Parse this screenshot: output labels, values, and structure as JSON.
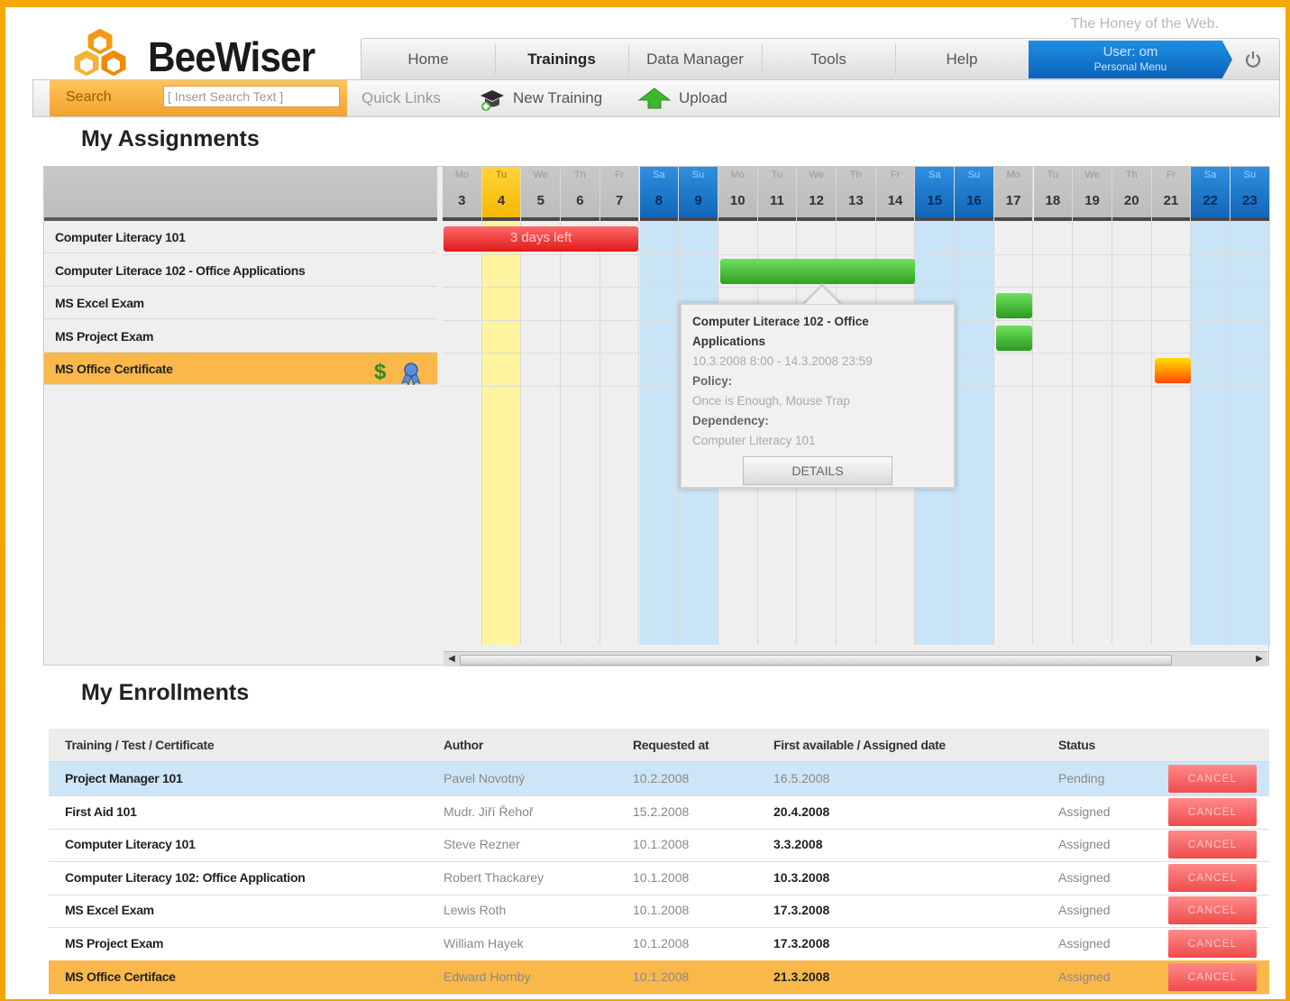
{
  "brand": {
    "logo_text": "BeeWiser",
    "tagline": "The Honey of the Web."
  },
  "nav": {
    "items": [
      "Home",
      "Trainings",
      "Data Manager",
      "Tools",
      "Help"
    ],
    "user_line1": "User: om",
    "user_line2": "Personal Menu"
  },
  "toolbar": {
    "search_label": "Search",
    "search_value": "[ Insert Search Text ]",
    "quick_links": "Quick Links",
    "new_training": "New Training",
    "upload": "Upload"
  },
  "assignments": {
    "title": "My Assignments",
    "days": [
      {
        "name": "Mo",
        "num": "3",
        "kind": "weekday"
      },
      {
        "name": "Tu",
        "num": "4",
        "kind": "today"
      },
      {
        "name": "We",
        "num": "5",
        "kind": "weekday"
      },
      {
        "name": "Th",
        "num": "6",
        "kind": "weekday"
      },
      {
        "name": "Fr",
        "num": "7",
        "kind": "weekday"
      },
      {
        "name": "Sa",
        "num": "8",
        "kind": "weekend"
      },
      {
        "name": "Su",
        "num": "9",
        "kind": "weekend"
      },
      {
        "name": "Mo",
        "num": "10",
        "kind": "weekday"
      },
      {
        "name": "Tu",
        "num": "11",
        "kind": "weekday"
      },
      {
        "name": "We",
        "num": "12",
        "kind": "weekday"
      },
      {
        "name": "Th",
        "num": "13",
        "kind": "weekday"
      },
      {
        "name": "Fr",
        "num": "14",
        "kind": "weekday"
      },
      {
        "name": "Sa",
        "num": "15",
        "kind": "weekend"
      },
      {
        "name": "Su",
        "num": "16",
        "kind": "weekend"
      },
      {
        "name": "Mo",
        "num": "17",
        "kind": "weekday"
      },
      {
        "name": "Tu",
        "num": "18",
        "kind": "weekday"
      },
      {
        "name": "We",
        "num": "19",
        "kind": "weekday"
      },
      {
        "name": "Th",
        "num": "20",
        "kind": "weekday"
      },
      {
        "name": "Fr",
        "num": "21",
        "kind": "weekday"
      },
      {
        "name": "Sa",
        "num": "22",
        "kind": "weekend"
      },
      {
        "name": "Su",
        "num": "23",
        "kind": "weekend"
      }
    ],
    "rows": [
      {
        "label": "Computer Literacy 101"
      },
      {
        "label": "Computer Literace 102 - Office Applications"
      },
      {
        "label": "MS Excel Exam"
      },
      {
        "label": "MS Project Exam"
      },
      {
        "label": "MS Office Certificate",
        "highlight": true
      }
    ],
    "bars": {
      "red_label": "3 days left"
    },
    "popup": {
      "title": "Computer Literace 102 - Office Applications",
      "dates": "10.3.2008 8:00 - 14.3.2008 23:59",
      "policy_label": "Policy:",
      "policy_value": "Once is Enough, Mouse Trap",
      "dependency_label": "Dependency:",
      "dependency_value": "Computer Literacy 101",
      "button": "DETAILS"
    }
  },
  "enrollments": {
    "title": "My Enrollments",
    "headers": [
      "Training / Test / Certificate",
      "Author",
      "Requested at",
      "First available / Assigned date",
      "Status"
    ],
    "cancel_label": "CANCEL",
    "rows": [
      {
        "title": "Project Manager 101",
        "author": "Pavel Novotný",
        "requested": "10.2.2008",
        "date": "16.5.2008",
        "status": "Pending",
        "style": "selected"
      },
      {
        "title": "First Aid 101",
        "author": "Mudr. Jiří Řehoř",
        "requested": "15.2.2008",
        "date": "20.4.2008",
        "status": "Assigned",
        "style": ""
      },
      {
        "title": "Computer Literacy 101",
        "author": "Steve Rezner",
        "requested": "10.1.2008",
        "date": "3.3.2008",
        "status": "Assigned",
        "style": ""
      },
      {
        "title": "Computer Literacy 102: Office Application",
        "author": "Robert Thackarey",
        "requested": "10.1.2008",
        "date": "10.3.2008",
        "status": "Assigned",
        "style": ""
      },
      {
        "title": "MS Excel Exam",
        "author": "Lewis Roth",
        "requested": "10.1.2008",
        "date": "17.3.2008",
        "status": "Assigned",
        "style": ""
      },
      {
        "title": "MS Project Exam",
        "author": "William Hayek",
        "requested": "10.1.2008",
        "date": "17.3.2008",
        "status": "Assigned",
        "style": ""
      },
      {
        "title": "MS Office Certiface",
        "author": "Edward Hornby",
        "requested": "10.1.2008",
        "date": "21.3.2008",
        "status": "Assigned",
        "style": "highlight"
      }
    ]
  },
  "colors": {
    "accent": "#f2a300",
    "selected_row": "#cde6f7",
    "highlight_row": "#fbb84a",
    "weekend": "#c9e4f7",
    "today": "#fff4a0"
  }
}
